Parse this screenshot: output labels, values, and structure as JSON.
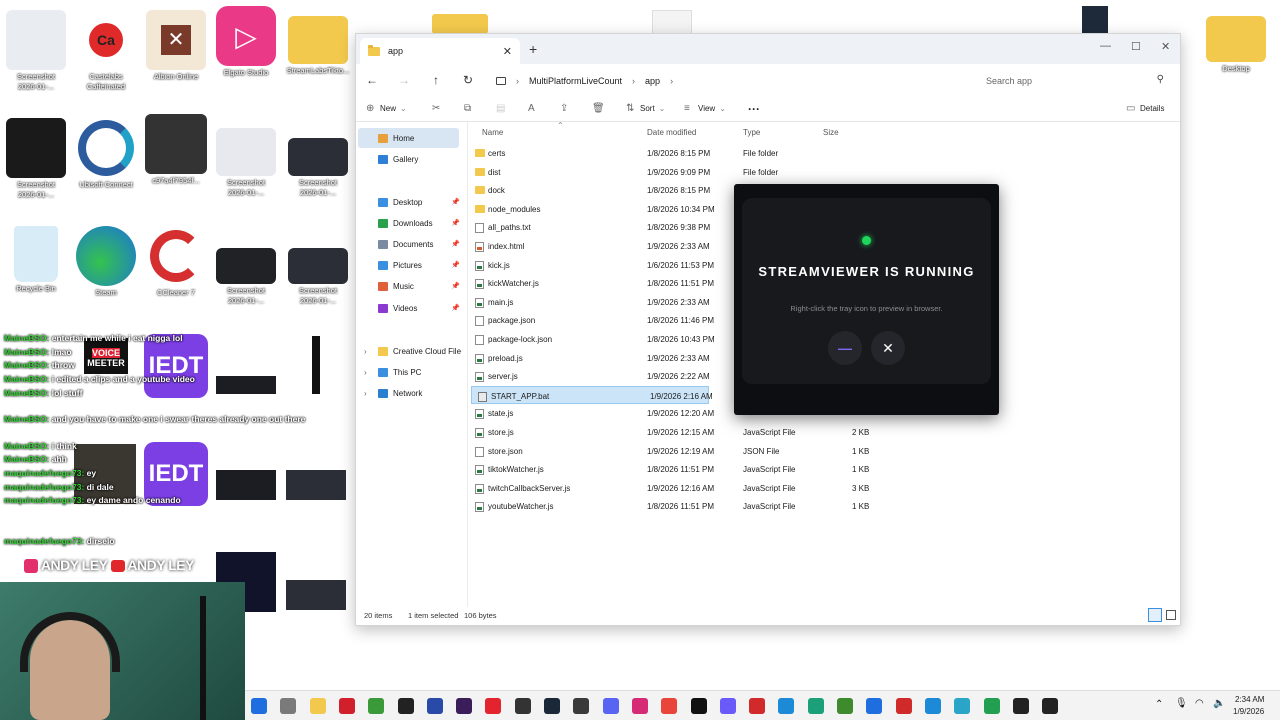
{
  "desktop": {
    "icons": [
      {
        "label": "Screenshot\n2026-01-...",
        "color": "#e9edf2"
      },
      {
        "label": "Castelabs\nCaffeinated",
        "color": "#ffffff"
      },
      {
        "label": "Albion Online",
        "color": "#f3e7d6"
      },
      {
        "label": "Elgato Studio",
        "color": "#ea3a87"
      },
      {
        "label": "StreamLabsTikto...",
        "color": "#f2c94c"
      },
      {
        "label": "Screenshot\n2026-01-...",
        "color": "#1a1a1a"
      },
      {
        "label": "Ubisoft Connect",
        "color": "#2d5c9e"
      },
      {
        "label": "c97a4f7954f...",
        "color": "#333333"
      },
      {
        "label": "Screenshot\n2026-01-...",
        "color": "#e7e9ee"
      },
      {
        "label": "Screenshot\n2026-01-...",
        "color": "#2b2e36"
      },
      {
        "label": "Recycle Bin",
        "color": "#d7ecf7"
      },
      {
        "label": "Steam",
        "color": "#2a8fd8"
      },
      {
        "label": "CCleaner 7",
        "color": "#d62f2f"
      },
      {
        "label": "Screenshot\n2026-01-...",
        "color": "#202225"
      },
      {
        "label": "Screenshot\n2026-01-...",
        "color": "#2b2e36"
      },
      {
        "label": "Desktop",
        "color": "#f2c94c"
      }
    ]
  },
  "explorer": {
    "tab_title": "app",
    "breadcrumb": [
      "MultiPlatformLiveCount",
      "app"
    ],
    "search_placeholder": "Search app",
    "toolbar": {
      "new": "New",
      "sort": "Sort",
      "view": "View",
      "more": "···",
      "details": "Details"
    },
    "sidebar": {
      "home": "Home",
      "gallery": "Gallery",
      "desktop": "Desktop",
      "downloads": "Downloads",
      "documents": "Documents",
      "pictures": "Pictures",
      "music": "Music",
      "videos": "Videos",
      "creative_cloud": "Creative Cloud File",
      "this_pc": "This PC",
      "network": "Network"
    },
    "columns": {
      "name": "Name",
      "date": "Date modified",
      "type": "Type",
      "size": "Size"
    },
    "files": [
      {
        "name": "certs",
        "date": "1/8/2026 8:15 PM",
        "type": "File folder",
        "size": "",
        "icon": "folder"
      },
      {
        "name": "dist",
        "date": "1/9/2026 9:09 PM",
        "type": "File folder",
        "size": "",
        "icon": "folder"
      },
      {
        "name": "dock",
        "date": "1/8/2026 8:15 PM",
        "type": "",
        "size": "",
        "icon": "folder"
      },
      {
        "name": "node_modules",
        "date": "1/8/2026 10:34 PM",
        "type": "",
        "size": "",
        "icon": "folder"
      },
      {
        "name": "all_paths.txt",
        "date": "1/8/2026 9:38 PM",
        "type": "",
        "size": "",
        "icon": "file"
      },
      {
        "name": "index.html",
        "date": "1/9/2026 2:33 AM",
        "type": "",
        "size": "",
        "icon": "html"
      },
      {
        "name": "kick.js",
        "date": "1/6/2026 11:53 PM",
        "type": "",
        "size": "",
        "icon": "js"
      },
      {
        "name": "kickWatcher.js",
        "date": "1/8/2026 11:51 PM",
        "type": "",
        "size": "",
        "icon": "js"
      },
      {
        "name": "main.js",
        "date": "1/9/2026 2:33 AM",
        "type": "",
        "size": "",
        "icon": "js"
      },
      {
        "name": "package.json",
        "date": "1/8/2026 11:46 PM",
        "type": "",
        "size": "",
        "icon": "file"
      },
      {
        "name": "package-lock.json",
        "date": "1/8/2026 10:43 PM",
        "type": "",
        "size": "",
        "icon": "file"
      },
      {
        "name": "preload.js",
        "date": "1/9/2026 2:33 AM",
        "type": "",
        "size": "",
        "icon": "js"
      },
      {
        "name": "server.js",
        "date": "1/9/2026 2:22 AM",
        "type": "",
        "size": "",
        "icon": "js"
      },
      {
        "name": "START_APP.bat",
        "date": "1/9/2026 2:16 AM",
        "type": "",
        "size": "",
        "icon": "bat"
      },
      {
        "name": "state.js",
        "date": "1/9/2026 12:20 AM",
        "type": "",
        "size": "",
        "icon": "js"
      },
      {
        "name": "store.js",
        "date": "1/9/2026 12:15 AM",
        "type": "JavaScript File",
        "size": "2 KB",
        "icon": "js"
      },
      {
        "name": "store.json",
        "date": "1/9/2026 12:19 AM",
        "type": "JSON File",
        "size": "1 KB",
        "icon": "file"
      },
      {
        "name": "tiktokWatcher.js",
        "date": "1/8/2026 11:51 PM",
        "type": "JavaScript File",
        "size": "1 KB",
        "icon": "js"
      },
      {
        "name": "twitchCallbackServer.js",
        "date": "1/9/2026 12:16 AM",
        "type": "JavaScript File",
        "size": "3 KB",
        "icon": "js"
      },
      {
        "name": "youtubeWatcher.js",
        "date": "1/8/2026 11:51 PM",
        "type": "JavaScript File",
        "size": "1 KB",
        "icon": "js"
      }
    ],
    "selected_index": 13,
    "status": {
      "count": "20 items",
      "selected": "1 item selected",
      "size": "106 bytes"
    }
  },
  "modal": {
    "title": "STREAMVIEWER IS RUNNING",
    "subtitle": "Right-click the tray icon to preview in browser.",
    "minimize": "—",
    "close": "✕",
    "status_color": "#1fd65a"
  },
  "chat": [
    {
      "user": "MaineBSO:",
      "msg": "entertain me while i eat nigga lol"
    },
    {
      "user": "MaineBSO:",
      "msg": "lmao"
    },
    {
      "user": "MaineBSO:",
      "msg": "throw"
    },
    {
      "user": "MaineBSO:",
      "msg": "i edited a clips and a youtube video"
    },
    {
      "user": "MaineBSO:",
      "msg": "lol stuff"
    },
    {
      "user": "MaineBSO:",
      "msg": "and you have to make one i swear theres already one out there"
    },
    {
      "user": "MaineBSO:",
      "msg": "i think"
    },
    {
      "user": "MaineBSO:",
      "msg": "ahh"
    },
    {
      "user": "maquinadefuego73:",
      "msg": "ey"
    },
    {
      "user": "maquinadefuego73:",
      "msg": "di dale"
    },
    {
      "user": "maquinadefuego73:",
      "msg": "ey dame ando cenando"
    },
    {
      "user": "maquinadefuego73:",
      "msg": "dirselo"
    }
  ],
  "overlay_labels": {
    "voice": "VOICE",
    "meeter": "MEETER",
    "iedt": "IEDT",
    "andy": "ANDY LEY"
  },
  "taskbar": {
    "time": "2:34 AM",
    "date": "1/9/2026",
    "icons": [
      "start-icon",
      "explorer-app-icon",
      "folder-app-icon",
      "opera-icon",
      "xbox-icon",
      "capcut-icon",
      "photoshop-icon",
      "premiere-icon",
      "youtube-music-icon",
      "epic-icon",
      "steam-icon",
      "obs-icon",
      "discord-icon",
      "instagram-icon",
      "chrome-icon",
      "tiktok-icon",
      "vpn-icon",
      "caffeinated-icon",
      "edge-icon",
      "edge-dev-icon",
      "minecraft-icon",
      "photos-icon",
      "caffeinated-app-icon",
      "edge-app-icon",
      "image-viewer-icon",
      "notepad-icon",
      "terminal-icon",
      "capcut-app-icon"
    ]
  }
}
